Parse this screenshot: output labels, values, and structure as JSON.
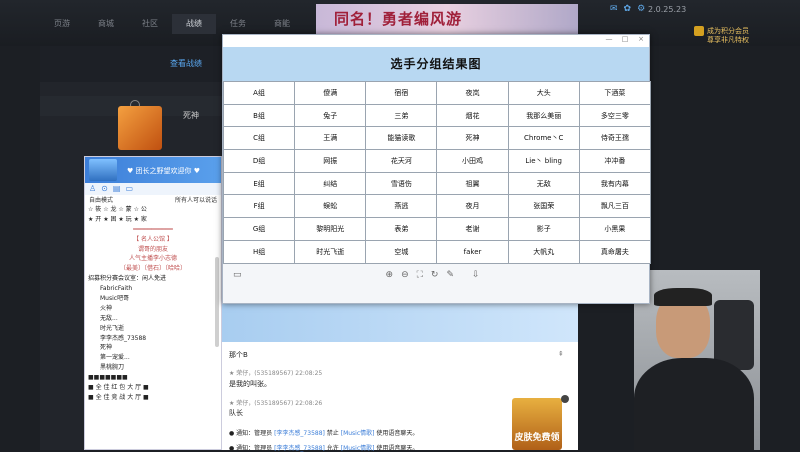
{
  "app": {
    "version": "2.0.25.23",
    "nav": [
      "页游",
      "商城",
      "社区",
      "战绩",
      "任务",
      "商能"
    ],
    "active_nav": "战绩",
    "sub_label": "查看战绩",
    "promo_line1": "成为积分会员",
    "promo_line2": "尊享非凡特权",
    "banner_text": "同名！勇者编风游",
    "profile_name": "死神"
  },
  "chat": {
    "header_title": "♥ 团长之野望欢迎你 ♥",
    "mode_left": "自由模式",
    "mode_right": "所有人可以说话",
    "list": [
      "☆ 筱 ☆ 龙 ☆ 蒙 ☆ 公",
      "★ 开 ★ 困 ★ 玩 ★ 家",
      "═══════════",
      "【 名人公馆 】",
      "谓哥的朋友",
      "人气主播李小志德",
      "〔最美〕〔借石〕〔哈哈〕",
      "招募积分赛会议室：闲人免进",
      "FabricFaith",
      "Music吧哥",
      "火神",
      "无敌...",
      "时光飞逝",
      "李李杰感_73588",
      "死神",
      "第一宠爱...",
      "黑桃腕刀",
      "■■■■■■■",
      "■ 全 佳 红 包 大 厅 ■",
      "■ 全 佳 竞 战 大 厅 ■"
    ]
  },
  "modal": {
    "title": "选手分组结果图",
    "window_buttons": [
      "—",
      "□",
      "×"
    ],
    "rows": [
      [
        "A组",
        "傻满",
        "宿宿",
        "夜岚",
        "大头",
        "下酒菜"
      ],
      [
        "B组",
        "兔子",
        "三弟",
        "烟花",
        "我那么美丽",
        "多空三零"
      ],
      [
        "C组",
        "王满",
        "能猫读歌",
        "死神",
        "Chrome丶C",
        "侍奇王孺"
      ],
      [
        "D组",
        "网振",
        "花天河",
        "小田鸡",
        "Lie丶 bling",
        "冲冲番"
      ],
      [
        "E组",
        "纠结",
        "雪语伤",
        "祖翼",
        "无敌",
        "我有内幕"
      ],
      [
        "F组",
        "蜈蚣",
        "燕逃",
        "夜月",
        "张国荣",
        "飘凡三百"
      ],
      [
        "G组",
        "黎明阳光",
        "表弟",
        "老谢",
        "影子",
        "小黑果"
      ],
      [
        "H组",
        "时光飞逝",
        "空城",
        "faker",
        "大帆丸",
        "真命屠夫"
      ]
    ]
  },
  "messages": {
    "line1": "那个B",
    "user1": "荣仔，(535189567)",
    "time1": "22:08:25",
    "text1": "是我的叫张。",
    "user2": "荣仔，(535189567)",
    "time2": "22:08:26",
    "text2": "队长",
    "sys1": "通知：管理员",
    "sys1b": "[李李杰感_73588]",
    "sys1c": "禁止",
    "sys1d": "[Music情歌]",
    "sys1e": "使用语音聊天。",
    "sys2": "通知：管理员",
    "sys2b": "[李李杰感_73588]",
    "sys2c": "允许",
    "sys2d": "[Music情歌]",
    "sys2e": "使用语音聊天。",
    "skin_label": "皮肤免费领"
  }
}
